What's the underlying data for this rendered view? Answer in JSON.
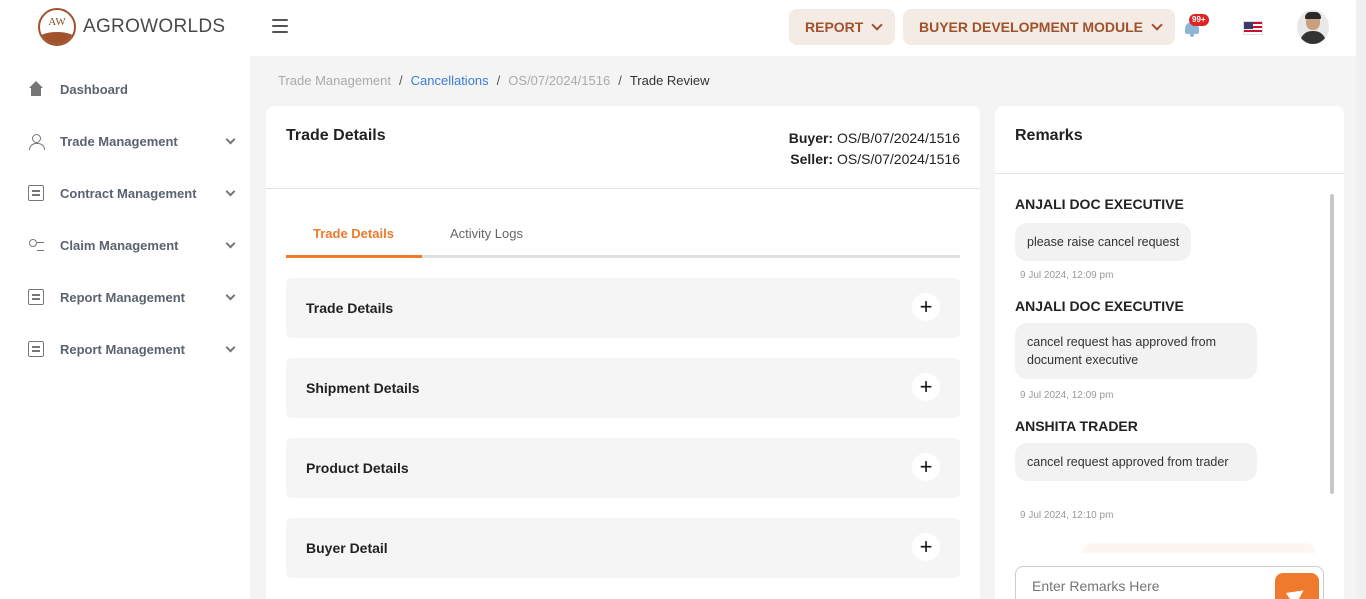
{
  "app": {
    "logo_mark": "AW",
    "name": "AGROWORLDS"
  },
  "header": {
    "report_label": "REPORT",
    "module_label": "BUYER DEVELOPMENT MODULE",
    "notification_count": "99+",
    "language": "en-US"
  },
  "sidebar": {
    "items": [
      {
        "label": "Dashboard",
        "icon": "home-icon"
      },
      {
        "label": "Trade Management",
        "icon": "users-icon",
        "expandable": true
      },
      {
        "label": "Contract Management",
        "icon": "document-icon",
        "expandable": true
      },
      {
        "label": "Claim Management",
        "icon": "claim-icon",
        "expandable": true
      },
      {
        "label": "Report Management",
        "icon": "document-icon",
        "expandable": true
      },
      {
        "label": "Report Management",
        "icon": "document-icon",
        "expandable": true
      }
    ]
  },
  "breadcrumb": {
    "items": [
      "Trade Management",
      "Cancellations",
      "OS/07/2024/1516",
      "Trade Review"
    ],
    "separator": "/"
  },
  "trade": {
    "title": "Trade Details",
    "buyer_label": "Buyer:",
    "buyer_value": "OS/B/07/2024/1516",
    "seller_label": "Seller:",
    "seller_value": "OS/S/07/2024/1516",
    "tabs": [
      {
        "label": "Trade Details",
        "active": true
      },
      {
        "label": "Activity Logs",
        "active": false
      }
    ],
    "sections": [
      "Trade Details",
      "Shipment Details",
      "Product Details",
      "Buyer Detail"
    ],
    "expand_symbol": "+"
  },
  "remarks": {
    "title": "Remarks",
    "messages": [
      {
        "author": "ANJALI DOC EXECUTIVE",
        "text": "please raise cancel request",
        "time": "9 Jul 2024, 12:09 pm"
      },
      {
        "author": "ANJALI DOC EXECUTIVE",
        "text": "cancel request has approved from document executive",
        "time": "9 Jul 2024, 12:09 pm"
      },
      {
        "author": "ANSHITA TRADER",
        "text": "cancel request approved from trader",
        "time": "9 Jul 2024, 12:10 pm"
      }
    ],
    "input_placeholder": "Enter Remarks Here"
  },
  "colors": {
    "accent": "#f07a2b",
    "brand": "#a0522d",
    "link": "#3b7dd8"
  }
}
